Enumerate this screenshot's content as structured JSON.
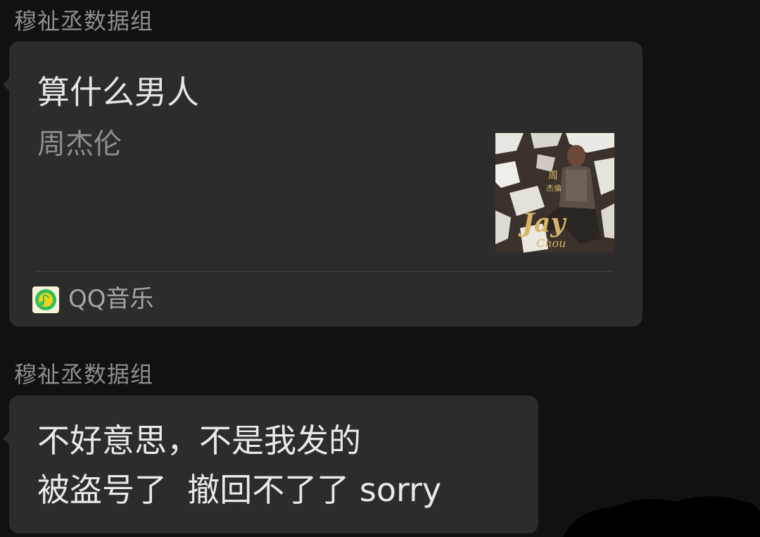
{
  "messages": [
    {
      "sender": "穆祉丞数据组",
      "type": "music-card",
      "song_title": "算什么男人",
      "artist": "周杰伦",
      "album_art": {
        "icon": "album-cover-image",
        "text_lines": [
          "周",
          "杰倫",
          "Jay",
          "Chou"
        ]
      },
      "app_name": "QQ音乐",
      "app_icon": "qq-music-icon"
    },
    {
      "sender": "穆祉丞数据组",
      "type": "text",
      "lines": [
        "不好意思，不是我发的",
        "被盗号了  撤回不了了 sorry"
      ]
    }
  ],
  "colors": {
    "background": "#111111",
    "bubble": "#2c2c2c",
    "sender_text": "#8f8f8f",
    "primary_text": "#e9e9e9",
    "secondary_text": "#8e8e8e",
    "app_icon_green": "#2fbf5a",
    "app_icon_yellow": "#f5d21a"
  }
}
